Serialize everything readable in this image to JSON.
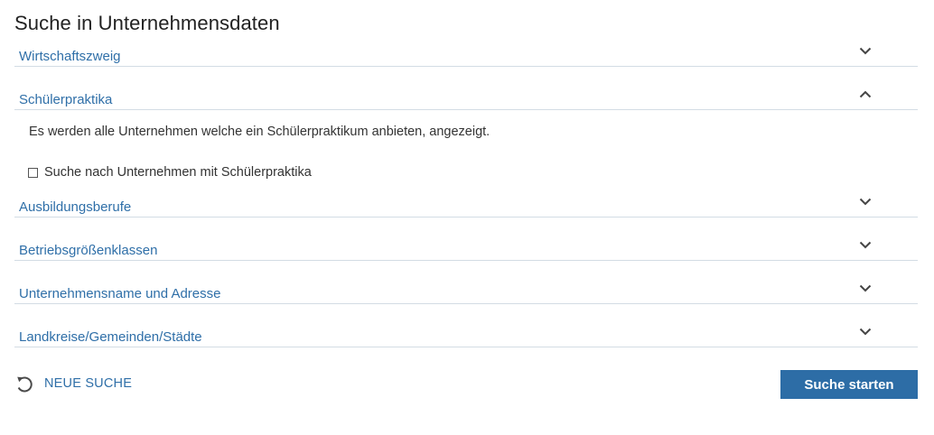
{
  "page": {
    "title": "Suche in Unternehmensdaten"
  },
  "sections": [
    {
      "label": "Wirtschaftszweig",
      "state": "collapsed",
      "icon": "chevron-down-icon"
    },
    {
      "label": "Schülerpraktika",
      "state": "expanded",
      "icon": "chevron-up-icon"
    },
    {
      "label": "Ausbildungsberufe",
      "state": "collapsed",
      "icon": "chevron-down-icon"
    },
    {
      "label": "Betriebsgrößenklassen",
      "state": "collapsed",
      "icon": "chevron-down-icon"
    },
    {
      "label": "Unternehmensname und Adresse",
      "state": "collapsed",
      "icon": "chevron-down-icon"
    },
    {
      "label": "Landkreise/Gemeinden/Städte",
      "state": "collapsed",
      "icon": "chevron-down-icon"
    }
  ],
  "schuelerpraktika": {
    "description": "Es werden alle Unternehmen welche ein Schülerpraktikum anbieten, angezeigt.",
    "checkbox_label": "Suche nach Unternehmen mit Schülerpraktika",
    "checkbox_checked": false
  },
  "actions": {
    "reset_label": "NEUE SUCHE",
    "reset_icon": "reset-icon",
    "start_label": "Suche starten"
  },
  "colors": {
    "link": "#2f6fa8",
    "primary_button": "#2d6da6",
    "divider": "#d3dce4",
    "text": "#333333"
  }
}
